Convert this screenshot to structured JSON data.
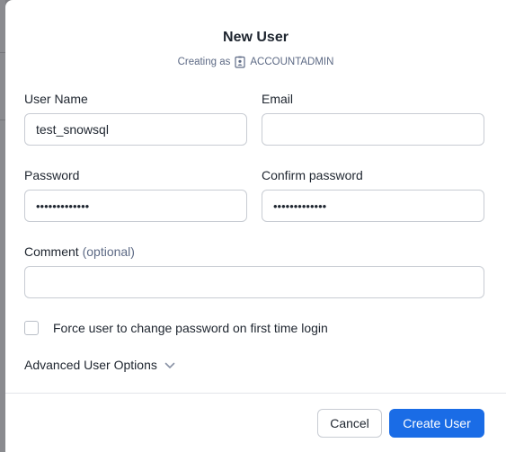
{
  "dialog": {
    "title": "New User",
    "creating_as_prefix": "Creating as",
    "role": "ACCOUNTADMIN",
    "role_icon": "id-badge-icon"
  },
  "fields": {
    "user_name": {
      "label": "User Name",
      "value": "test_snowsql",
      "placeholder": ""
    },
    "email": {
      "label": "Email",
      "value": "",
      "placeholder": ""
    },
    "password": {
      "label": "Password",
      "masked_value": "•••••••••••••"
    },
    "confirm_password": {
      "label": "Confirm password",
      "masked_value": "•••••••••••••"
    },
    "comment": {
      "label": "Comment",
      "optional_hint": "(optional)",
      "value": "",
      "placeholder": ""
    }
  },
  "force_change": {
    "label": "Force user to change password on first time login",
    "checked": false
  },
  "advanced": {
    "label": "Advanced User Options",
    "icon": "chevron-down-icon"
  },
  "buttons": {
    "cancel": "Cancel",
    "create": "Create User"
  },
  "colors": {
    "primary": "#1a6ce6",
    "muted_text": "#5d6a85",
    "border": "#c8ccd3"
  }
}
